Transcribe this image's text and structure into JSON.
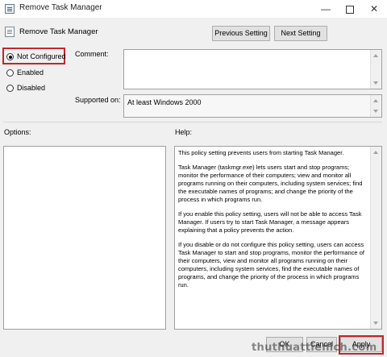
{
  "window": {
    "title": "Remove Task Manager"
  },
  "header": {
    "policy_name": "Remove Task Manager",
    "prev_label": "Previous Setting",
    "next_label": "Next Setting"
  },
  "state": {
    "options": [
      {
        "label": "Not Configured",
        "selected": true
      },
      {
        "label": "Enabled",
        "selected": false
      },
      {
        "label": "Disabled",
        "selected": false
      }
    ]
  },
  "comment": {
    "label": "Comment:",
    "value": ""
  },
  "supported": {
    "label": "Supported on:",
    "value": "At least Windows 2000"
  },
  "options_section": {
    "label": "Options:"
  },
  "help_section": {
    "label": "Help:",
    "paragraphs": [
      "This policy setting prevents users from starting Task Manager.",
      "Task Manager (taskmgr.exe) lets users start and stop programs; monitor the performance of their computers; view and monitor all programs running on their computers, including system services; find the executable names of programs; and change the priority of the process in which programs run.",
      "If you enable this policy setting, users will not be able to access Task Manager. If users try to start Task Manager, a message appears explaining that a policy prevents the action.",
      "If you disable or do not configure this policy setting, users can access Task Manager to  start and stop programs, monitor the performance of their computers, view and monitor all programs running on their computers, including system services, find the executable names of programs, and change the priority of the process in which programs run."
    ]
  },
  "footer": {
    "ok_label": "OK",
    "cancel_label": "Cancel",
    "apply_label": "Apply"
  },
  "watermark": "thuthuattienich.com",
  "colors": {
    "highlight": "#c0272d"
  }
}
